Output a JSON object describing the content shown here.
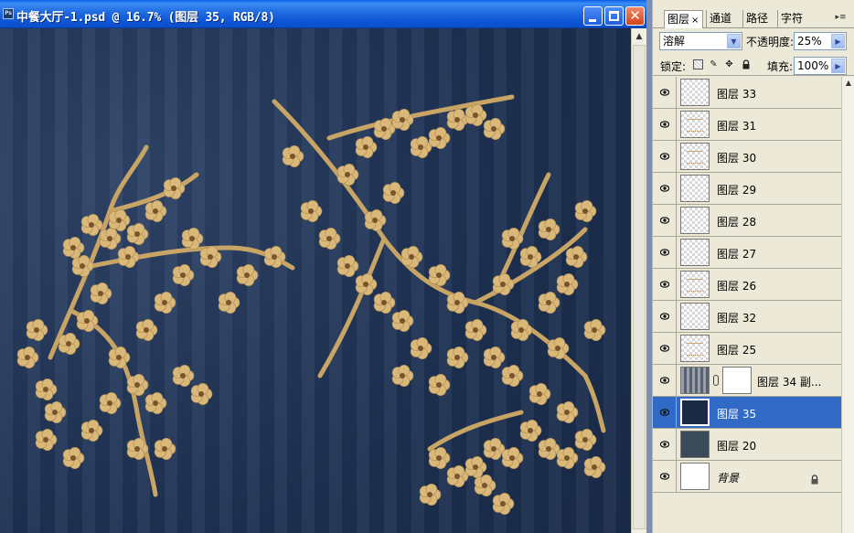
{
  "document": {
    "app_icon": "Ps",
    "title": "中餐大厅-1.psd @ 16.7% (图层 35, RGB/8)",
    "controls": {
      "minimize": "minimize-icon",
      "maximize": "maximize-icon",
      "close": "✕"
    }
  },
  "panel": {
    "tabs": [
      {
        "label": "图层",
        "active": true,
        "close": "×"
      },
      {
        "label": "通道"
      },
      {
        "label": "路径"
      },
      {
        "label": "字符"
      }
    ],
    "blend_mode": "溶解",
    "opacity_label": "不透明度:",
    "opacity": "25%",
    "lock_label": "锁定:",
    "fill_label": "填充:",
    "fill": "100%",
    "layers": [
      {
        "name": "图层 33",
        "thumb": "transparent",
        "visible": true
      },
      {
        "name": "图层 31",
        "thumb": "art",
        "visible": true
      },
      {
        "name": "图层 30",
        "thumb": "art",
        "visible": true
      },
      {
        "name": "图层 29",
        "thumb": "transparent",
        "visible": true
      },
      {
        "name": "图层 28",
        "thumb": "transparent",
        "visible": true
      },
      {
        "name": "图层 27",
        "thumb": "transparent",
        "visible": true
      },
      {
        "name": "图层 26",
        "thumb": "art",
        "visible": true
      },
      {
        "name": "图层 32",
        "thumb": "transparent",
        "visible": true
      },
      {
        "name": "图层 25",
        "thumb": "art",
        "visible": true
      },
      {
        "name": "图层 34 副...",
        "thumb": "pattern",
        "has_mask": true,
        "visible": true
      },
      {
        "name": "图层 35",
        "thumb": "navy",
        "selected": true,
        "visible": true
      },
      {
        "name": "图层 20",
        "thumb": "slate",
        "visible": true
      },
      {
        "name": "背景",
        "thumb": "white",
        "locked": true,
        "italic": true,
        "visible": true
      }
    ]
  },
  "colors": {
    "canvas_background": "#1e3152",
    "blossom": "#d9b879",
    "blossom_center": "#7a5428",
    "selected_row": "#316ac5",
    "titlebar": "#0d55d6"
  }
}
